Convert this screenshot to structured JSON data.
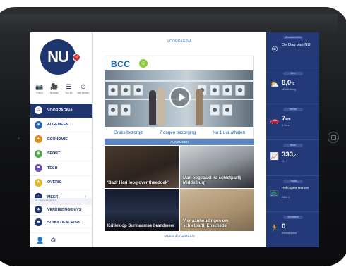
{
  "sidebar": {
    "logo_text": "NU",
    "logo_badge": "nl",
    "quick_actions": [
      {
        "icon": "camera-icon",
        "glyph": "📷",
        "label": "Foto's"
      },
      {
        "icon": "video-icon",
        "glyph": "🎥",
        "label": "NUtube"
      },
      {
        "icon": "list-icon",
        "glyph": "☰",
        "label": "Top 10"
      },
      {
        "icon": "clock-icon",
        "glyph": "⏱",
        "label": "Net binnen"
      }
    ],
    "nav_items": [
      {
        "label": "VOORPAGINA",
        "color": "#1f3570"
      },
      {
        "label": "ALGEMEEN",
        "color": "#2d64b8"
      },
      {
        "label": "ECONOMIE",
        "color": "#d98e1f"
      },
      {
        "label": "SPORT",
        "color": "#4ea84b"
      },
      {
        "label": "TECH",
        "color": "#6a4fb0"
      },
      {
        "label": "OVERIG",
        "color": "#e0b72b"
      },
      {
        "label": "MEER",
        "color": "#1f3570"
      }
    ],
    "dossiers_heading": "NU.NLDOSSIERS",
    "dossiers": [
      {
        "label": "VERKIEZINGEN VS"
      },
      {
        "label": "SCHULDENCRISIS"
      }
    ]
  },
  "main": {
    "title": "VOORPAGINA",
    "ad": {
      "brand": "BCC",
      "features": [
        "Gratis bezorgd",
        "7 dagen bezorging",
        "Na 1 uur afhalen"
      ]
    },
    "section_label": "ALGEMEEN",
    "tiles": [
      {
        "caption": "'Badr Hari loog over theedoek'"
      },
      {
        "caption": "Man opgepakt na schietpartij Middelburg"
      },
      {
        "caption": "Kritiek op Surinaamse brandweer"
      },
      {
        "caption": "Vier aanhoudingen om schietpartij Enschede"
      }
    ],
    "more_link": "MEER ALGEMEEN"
  },
  "rail": {
    "widgets": [
      {
        "header": "Nieuwsberichten",
        "icon": "nu-icon",
        "glyph": "◎",
        "text": "De Dag van NU"
      },
      {
        "header": "Weer",
        "icon": "weather-icon",
        "glyph": "⛅",
        "value": "8,0",
        "unit": "°c",
        "sub": "Middelburg"
      },
      {
        "header": "Verkeer",
        "icon": "traffic-icon",
        "glyph": "🚗",
        "value": "7",
        "unit": "km",
        "sub": "1 files"
      },
      {
        "header": "Beurs",
        "icon": "stocks-icon",
        "glyph": "📈",
        "value": "333",
        "unit": ",27",
        "sub": "G.I."
      },
      {
        "header": "TV-gids",
        "icon": "tv-icon",
        "glyph": "📺",
        "text": "Helicopter Heroes",
        "sub": "BBC 1"
      },
      {
        "header": "Sportstand",
        "icon": "runner-icon",
        "glyph": "🏃",
        "value": "0",
        "sub": "Wedstrijden"
      }
    ]
  }
}
